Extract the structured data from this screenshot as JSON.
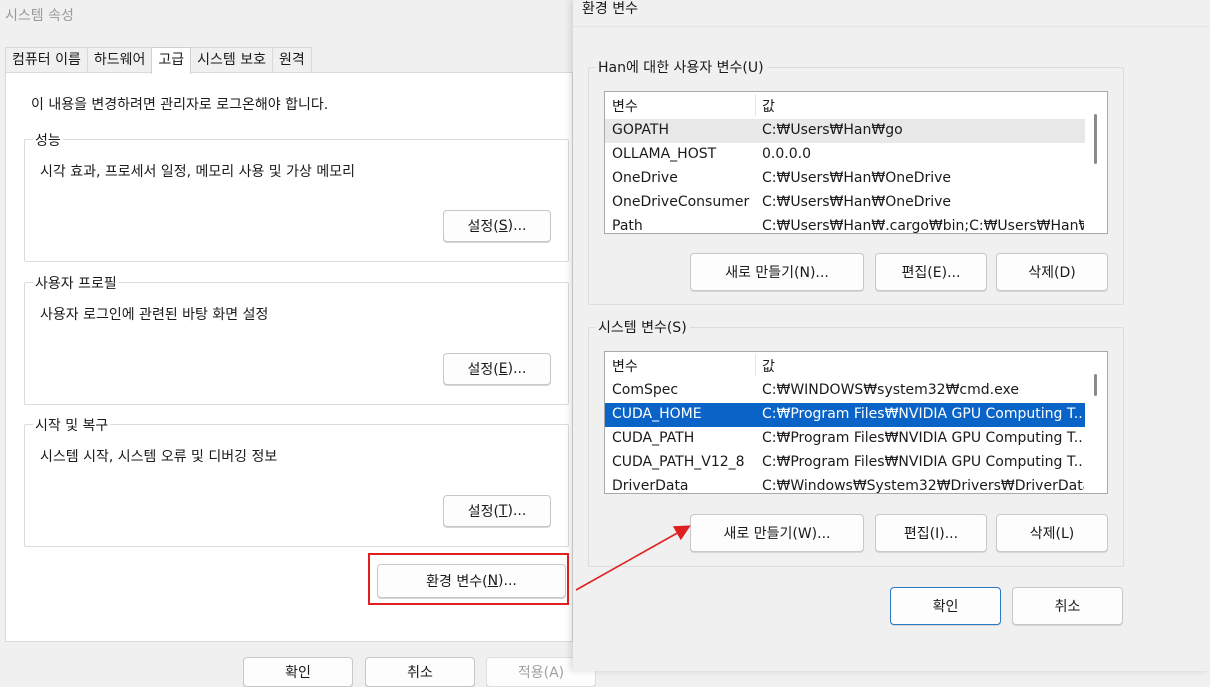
{
  "system_properties": {
    "title": "시스템 속성",
    "tabs": [
      "컴퓨터 이름",
      "하드웨어",
      "고급",
      "시스템 보호",
      "원격"
    ],
    "admin_note": "이 내용을 변경하려면 관리자로 로그온해야 합니다.",
    "performance": {
      "title": "성능",
      "desc": "시각 효과, 프로세서 일정, 메모리 사용 및 가상 메모리",
      "button_pre": "설정(",
      "button_key": "S",
      "button_post": ")..."
    },
    "user_profile": {
      "title": "사용자 프로필",
      "desc": "사용자 로그인에 관련된 바탕 화면 설정",
      "button_pre": "설정(",
      "button_key": "E",
      "button_post": ")..."
    },
    "startup_recovery": {
      "title": "시작 및 복구",
      "desc": "시스템 시작, 시스템 오류 및 디버깅 정보",
      "button_pre": "설정(",
      "button_key": "T",
      "button_post": ")..."
    },
    "env_button_pre": "환경 변수(",
    "env_button_key": "N",
    "env_button_post": ")...",
    "ok": "확인",
    "cancel": "취소",
    "apply": "적용(A)"
  },
  "env_window": {
    "title": "환경 변수",
    "user_vars": {
      "title": "Han에 대한 사용자 변수(U)",
      "col_var": "변수",
      "col_val": "값",
      "rows": [
        {
          "name": "GOPATH",
          "value": "C:₩Users₩Han₩go"
        },
        {
          "name": "OLLAMA_HOST",
          "value": "0.0.0.0"
        },
        {
          "name": "OneDrive",
          "value": "C:₩Users₩Han₩OneDrive"
        },
        {
          "name": "OneDriveConsumer",
          "value": "C:₩Users₩Han₩OneDrive"
        },
        {
          "name": "Path",
          "value": "C:₩Users₩Han₩.cargo₩bin;C:₩Users₩Han₩.l..."
        }
      ],
      "new_btn": "새로 만들기(N)...",
      "edit_btn": "편집(E)...",
      "delete_btn": "삭제(D)"
    },
    "system_vars": {
      "title": "시스템 변수(S)",
      "col_var": "변수",
      "col_val": "값",
      "rows": [
        {
          "name": "ComSpec",
          "value": "C:₩WINDOWS₩system32₩cmd.exe"
        },
        {
          "name": "CUDA_HOME",
          "value": "C:₩Program Files₩NVIDIA GPU Computing T..."
        },
        {
          "name": "CUDA_PATH",
          "value": "C:₩Program Files₩NVIDIA GPU Computing T..."
        },
        {
          "name": "CUDA_PATH_V12_8",
          "value": "C:₩Program Files₩NVIDIA GPU Computing T..."
        },
        {
          "name": "DriverData",
          "value": "C:₩Windows₩System32₩Drivers₩DriverData"
        }
      ],
      "new_btn": "새로 만들기(W)...",
      "edit_btn": "편집(I)...",
      "delete_btn": "삭제(L)"
    },
    "ok": "확인",
    "cancel": "취소"
  },
  "colors": {
    "highlight_box": "#e02020",
    "selection": "#0a64c8"
  }
}
